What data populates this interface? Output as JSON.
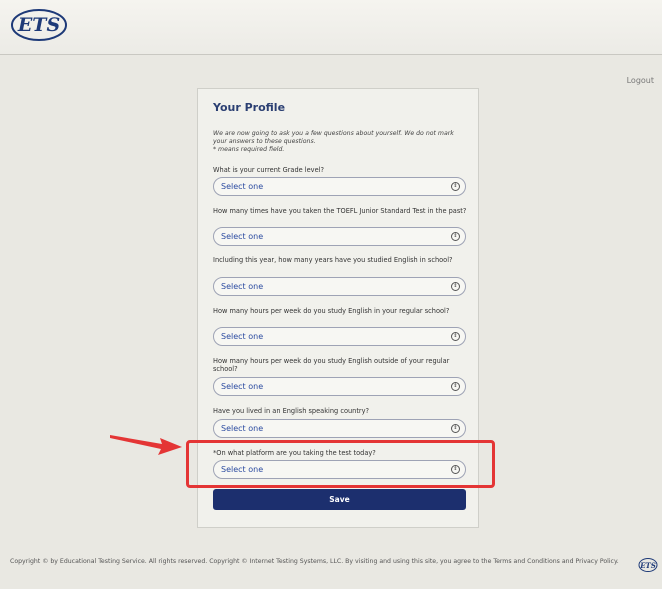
{
  "header": {
    "logo_text": "ETS",
    "logout_label": "Logout"
  },
  "profile": {
    "title": "Your Profile",
    "intro_line1": "We are now going to ask you a few questions about yourself. We do not mark your answers to these questions.",
    "intro_line2": "* means required field.",
    "questions": [
      {
        "label": "What is your current Grade level?",
        "value": "Select one"
      },
      {
        "label": "How many times have you taken the TOEFL Junior Standard Test in the past?",
        "value": "Select one"
      },
      {
        "label": "Including this year, how many years have you studied English in school?",
        "value": "Select one"
      },
      {
        "label": "How many hours per week do you study English in your regular school?",
        "value": "Select one"
      },
      {
        "label": "How many hours per week do you study English outside of your regular school?",
        "value": "Select one"
      },
      {
        "label": "Have you lived in an English speaking country?",
        "value": "Select one"
      },
      {
        "label": "*On what platform are you taking the test today?",
        "value": "Select one"
      }
    ],
    "save_label": "Save"
  },
  "annotation": {
    "arrow_color": "#e43535",
    "highlight_color": "#e43535"
  },
  "footer": {
    "text": "Copyright © by Educational Testing Service. All rights reserved. Copyright © Internet Testing Systems, LLC. By visiting and using this site, you agree to the Terms and Conditions and Privacy Policy.",
    "logo_text": "ETS"
  }
}
